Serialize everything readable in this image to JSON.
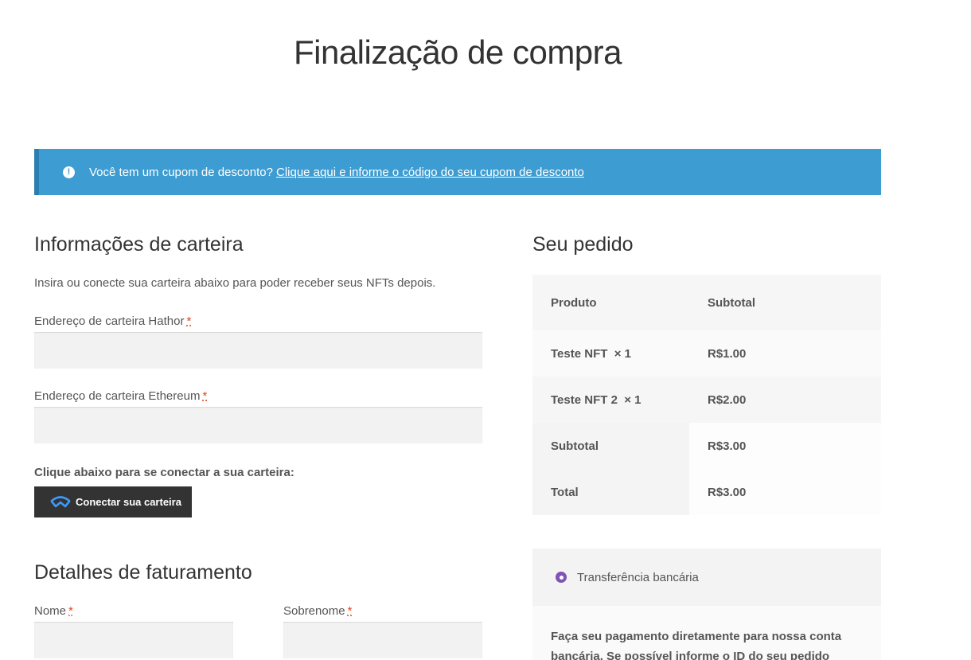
{
  "page": {
    "title": "Finalização de compra"
  },
  "notice": {
    "text": "Você tem um cupom de desconto?",
    "link": "Clique aqui e informe o código do seu cupom de desconto",
    "icon": "info-icon"
  },
  "wallet": {
    "heading": "Informações de carteira",
    "description": "Insira ou conecte sua carteira abaixo para poder receber seus NFTs depois.",
    "hathor_label": "Endereço de carteira Hathor",
    "hathor_value": "",
    "ethereum_label": "Endereço de carteira Ethereum",
    "ethereum_value": "",
    "connect_prompt": "Clique abaixo para se conectar a sua carteira:",
    "connect_button": "Conectar sua carteira",
    "required_mark": "*"
  },
  "billing": {
    "heading": "Detalhes de faturamento",
    "first_name_label": "Nome",
    "last_name_label": "Sobrenome",
    "first_name_value": "",
    "last_name_value": ""
  },
  "order": {
    "heading": "Seu pedido",
    "columns": [
      "Produto",
      "Subtotal"
    ],
    "items": [
      {
        "name": "Teste NFT",
        "qty": "× 1",
        "subtotal": "R$1.00"
      },
      {
        "name": "Teste NFT 2",
        "qty": "× 1",
        "subtotal": "R$2.00"
      }
    ],
    "subtotal_label": "Subtotal",
    "subtotal_value": "R$3.00",
    "total_label": "Total",
    "total_value": "R$3.00"
  },
  "payment": {
    "method": "Transferência bancária",
    "description": "Faça seu pagamento diretamente para nossa conta bancária. Se possível informe o ID do seu pedido como"
  },
  "colors": {
    "notice_bg": "#3d9cd2",
    "button_bg": "#333333",
    "radio": "#7f54b3",
    "required": "#e2401c"
  }
}
